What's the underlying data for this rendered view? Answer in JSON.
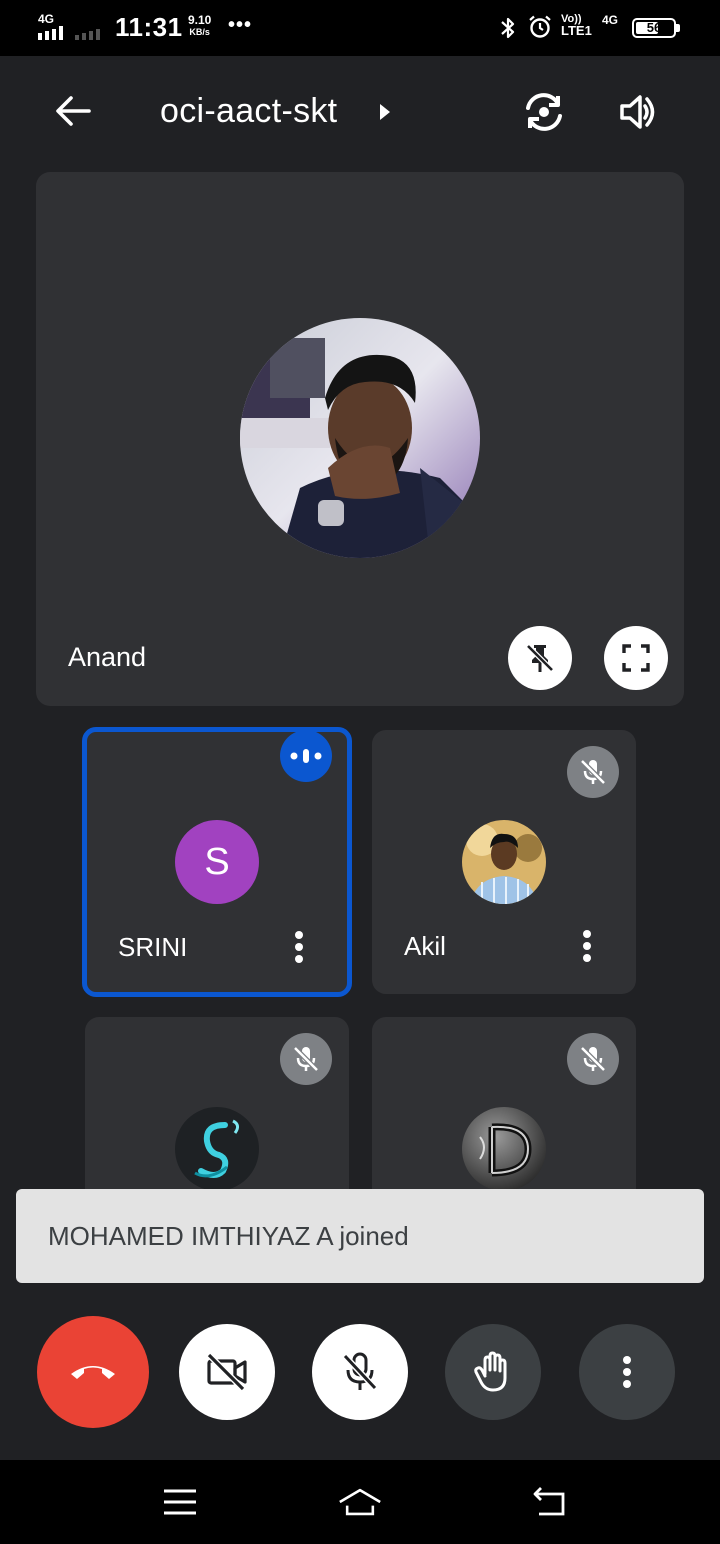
{
  "status_bar": {
    "network": "4G",
    "time": "11:31",
    "speed_value": "9.10",
    "speed_unit": "KB/s",
    "more": "•••",
    "volte_top": "Vo))",
    "volte_bottom": "LTE1",
    "network2": "4G",
    "battery": "56"
  },
  "header": {
    "title": "oci-aact-skt",
    "icons": [
      "back-arrow-icon",
      "caret-right-icon",
      "switch-camera-icon",
      "speaker-icon"
    ]
  },
  "main_tile": {
    "name": "Anand",
    "icons": [
      "unpin-icon",
      "fullscreen-icon"
    ]
  },
  "participants": [
    {
      "name": "SRINI",
      "initial": "S",
      "status": "speaking"
    },
    {
      "name": "Akil",
      "status": "muted"
    },
    {
      "name": "",
      "status": "muted"
    },
    {
      "name": "",
      "status": "muted"
    }
  ],
  "toast": {
    "text": "MOHAMED IMTHIYAZ A joined"
  },
  "controls": [
    "end-call-icon",
    "camera-off-icon",
    "mic-off-icon",
    "raise-hand-icon",
    "more-vert-icon"
  ],
  "nav": [
    "menu-icon",
    "home-icon",
    "back-icon"
  ],
  "colors": {
    "background": "#202124",
    "tile": "#303134",
    "active_border": "#0b57d0",
    "end_call": "#ea4335",
    "avatar_purple": "#a142c0"
  }
}
